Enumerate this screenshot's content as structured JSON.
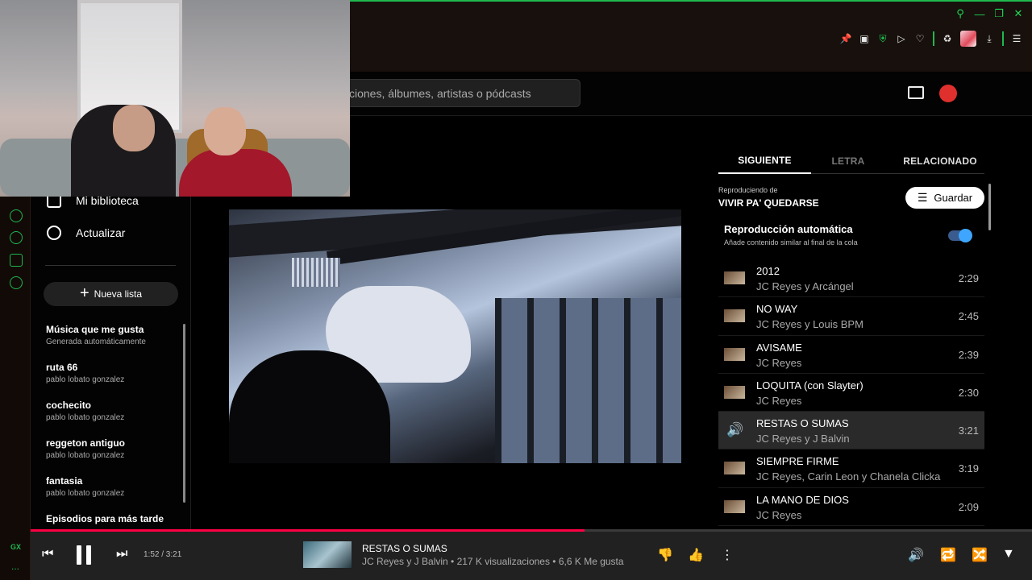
{
  "browser": {
    "window_controls": [
      "search-icon",
      "minimize-icon",
      "restore-icon",
      "close-icon"
    ],
    "toolbar_icons": [
      "pin-icon",
      "snapshot-icon",
      "shield-icon",
      "play-icon",
      "heart-icon",
      "extensions-icon",
      "profile-extension",
      "download-icon",
      "menu-icon"
    ],
    "sidebar_label": "GX",
    "sidebar_more": "...",
    "accent_color": "#1fb84e"
  },
  "header": {
    "search_placeholder": "ciones, álbumes, artistas o pódcasts"
  },
  "nav": {
    "library": "Mi biblioteca",
    "upgrade": "Actualizar",
    "new_list": "Nueva lista",
    "playlists": [
      {
        "title": "Música que me gusta",
        "subtitle": "Generada automáticamente"
      },
      {
        "title": "ruta 66",
        "subtitle": "pablo lobato gonzalez"
      },
      {
        "title": "cochecito",
        "subtitle": "pablo lobato gonzalez"
      },
      {
        "title": "reggeton antiguo",
        "subtitle": "pablo lobato gonzalez"
      },
      {
        "title": "fantasia",
        "subtitle": "pablo lobato gonzalez"
      },
      {
        "title": "Episodios para más tarde",
        "subtitle": ""
      }
    ]
  },
  "panel": {
    "tabs": [
      "SIGUIENTE",
      "LETRA",
      "RELACIONADO"
    ],
    "playing_from_label": "Reproduciendo de",
    "playing_from_title": "VIVIR PA' QUEDARSE",
    "save_label": "Guardar",
    "autoplay_title": "Reproducción automática",
    "autoplay_subtitle": "Añade contenido similar al final de la cola",
    "autoplay_on": true,
    "queue": [
      {
        "title": "2012",
        "artist": "JC Reyes y Arcángel",
        "duration": "2:29"
      },
      {
        "title": "NO WAY",
        "artist": "JC Reyes y Louis BPM",
        "duration": "2:45"
      },
      {
        "title": "AVISAME",
        "artist": "JC Reyes",
        "duration": "2:39"
      },
      {
        "title": "LOQUITA (con Slayter)",
        "artist": "JC Reyes",
        "duration": "2:30"
      },
      {
        "title": "RESTAS O SUMAS",
        "artist": "JC Reyes y J Balvin",
        "duration": "3:21",
        "current": true
      },
      {
        "title": "SIEMPRE FIRME",
        "artist": "JC Reyes, Carin Leon y Chanela Clicka",
        "duration": "3:19"
      },
      {
        "title": "LA MANO DE DIOS",
        "artist": "JC Reyes",
        "duration": "2:09"
      }
    ]
  },
  "player": {
    "time": "1:52 / 3:21",
    "progress": 0.553,
    "title": "RESTAS O SUMAS",
    "subtitle": "JC Reyes y J Balvin • 217 K visualizaciones • 6,6 K Me gusta",
    "progress_color": "#ff0044"
  }
}
